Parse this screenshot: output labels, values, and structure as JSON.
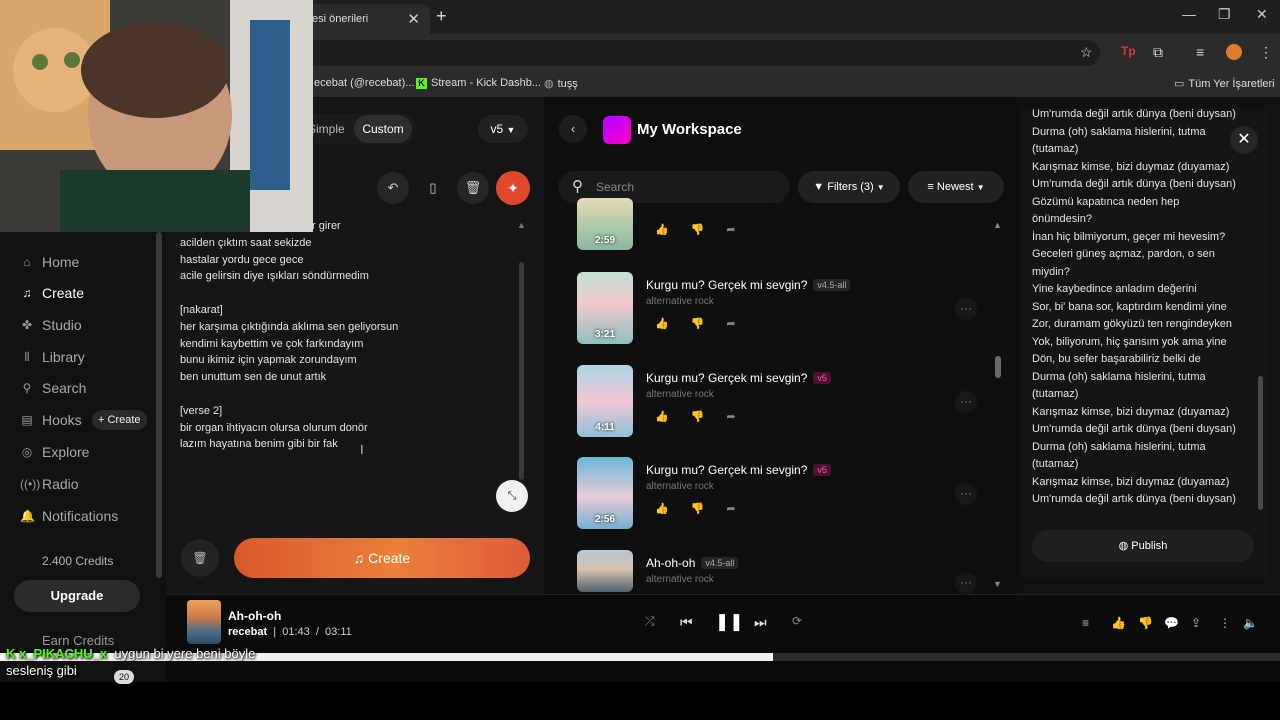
{
  "browser": {
    "tab_title": "esi önerileri",
    "bookmarks": [
      {
        "label": "ecebat (@recebat)..."
      },
      {
        "label": "Stream - Kick Dashb..."
      },
      {
        "label": "tuşş"
      }
    ],
    "all_bookmarks": "Tüm Yer İşaretleri"
  },
  "sidebar": {
    "items": [
      {
        "label": "Home",
        "icon": "home-icon"
      },
      {
        "label": "Create",
        "icon": "music-note-icon",
        "active": true
      },
      {
        "label": "Studio",
        "icon": "studio-icon"
      },
      {
        "label": "Library",
        "icon": "library-icon"
      },
      {
        "label": "Search",
        "icon": "search-icon"
      },
      {
        "label": "Hooks",
        "icon": "hooks-icon"
      },
      {
        "label": "Explore",
        "icon": "explore-icon"
      },
      {
        "label": "Radio",
        "icon": "radio-icon"
      },
      {
        "label": "Notifications",
        "icon": "bell-icon"
      }
    ],
    "hooks_create": "+ Create",
    "credits": "2.400 Credits",
    "upgrade": "Upgrade",
    "earn_credits": "Earn Credits"
  },
  "create_panel": {
    "mode_simple": "Simple",
    "mode_custom": "Custom",
    "version": "v5",
    "lyrics_lines": [
      "r girer",
      "acilden çıktım saat sekizde",
      "hastalar yordu gece gece",
      "acile gelirsin diye ışıkları söndürmedim",
      "",
      "[nakarat]",
      "her karşıma çıktığında aklıma sen geliyorsun",
      "kendimi kaybettim ve çok farkındayım",
      "bunu ikimiz için yapmak zorundayım",
      "ben unuttum sen de unut artık",
      "",
      "[verse 2]",
      "bir organ ihtiyacın olursa olurum donör",
      "lazım hayatına benim gibi bir fak"
    ],
    "create_button": "Create"
  },
  "workspace": {
    "title": "My Workspace",
    "search_placeholder": "Search",
    "filters": "Filters (3)",
    "sort": "Newest",
    "songs": [
      {
        "title": "",
        "style": "",
        "badge": "",
        "duration": "2:59"
      },
      {
        "title": "Kurgu mu? Gerçek mi sevgin?",
        "style": "alternative rock",
        "badge": "v4.5-all",
        "duration": "3:21"
      },
      {
        "title": "Kurgu mu? Gerçek mi sevgin?",
        "style": "alternative rock",
        "badge": "v5",
        "duration": "4:11"
      },
      {
        "title": "Kurgu mu? Gerçek mi sevgin?",
        "style": "alternative rock",
        "badge": "v5",
        "duration": "2:56"
      },
      {
        "title": "Ah-oh-oh",
        "style": "alternative rock",
        "badge": "v4.5-all",
        "duration": ""
      }
    ]
  },
  "lyrics_panel": {
    "lines": [
      "Um'rumda değil artık dünya (beni duysan)",
      "Durma (oh) saklama hislerini, tutma",
      "(tutamaz)",
      "Karışmaz kimse, bizi duymaz (duyamaz)",
      "Um'rumda değil artık dünya (beni duysan)",
      "Gözümü kapatınca neden hep",
      "önümdesin?",
      "İnan hiç bilmiyorum, geçer mi hevesim?",
      "Geceleri güneş açmaz, pardon, o sen",
      "miydin?",
      "Yine kaybedince anladım değerini",
      "Sor, bi' bana sor, kaptırdım kendimi yine",
      "Zor, duramam gökyüzü ten rengindeyken",
      "Yok, biliyorum, hiç şansım yok ama yine",
      "Dön, bu sefer başarabiliriz belki de",
      "Durma (oh) saklama hislerini, tutma",
      "(tutamaz)",
      "Karışmaz kimse, bizi duymaz (duyamaz)",
      "Um'rumda değil artık dünya (beni duysan)",
      "Durma (oh) saklama hislerini, tutma",
      "(tutamaz)",
      "Karışmaz kimse, bizi duymaz (duyamaz)",
      "Um'rumda değil artık dünya (beni duysan)"
    ],
    "publish": "Publish"
  },
  "player": {
    "title": "Ah-oh-oh",
    "artist": "recebat",
    "current_time": "01:43",
    "total_time": "03:11",
    "progress": 0.604
  },
  "chat": {
    "user": "x_PIKACHU_x",
    "message": "uygun bi yere beni böyle",
    "message2": "sesleniş gibi",
    "viewer_count": "20"
  }
}
